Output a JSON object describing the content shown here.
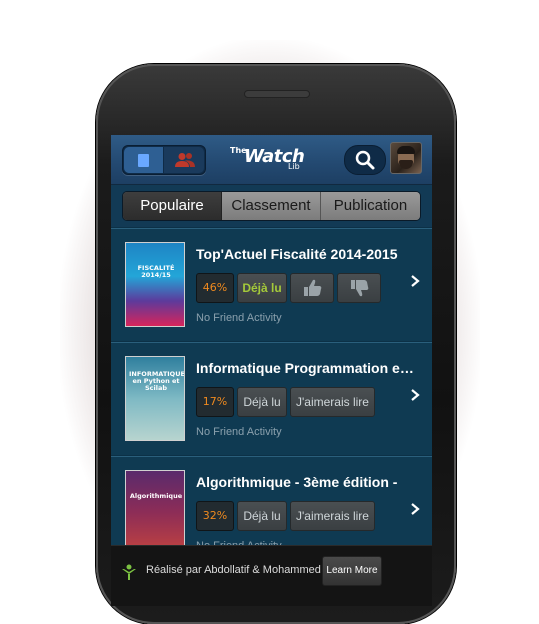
{
  "app": {
    "logo_the": "The",
    "logo_watch": "Watch",
    "logo_lib": "Lib"
  },
  "icons": {
    "books": "book-icon",
    "friends": "users-icon",
    "search": "search-icon",
    "chevron": "chevron-right-icon",
    "like": "thumbs-up-icon",
    "dislike": "thumbs-down-icon"
  },
  "colors": {
    "topbar": "#2f5b86",
    "list_bg": "#0f3a52",
    "percent": "#f08a1f",
    "done": "#a4c93a"
  },
  "tabs": [
    "Populaire",
    "Classement",
    "Publication"
  ],
  "active_tab": "Populaire",
  "books": [
    {
      "title": "Top'Actuel Fiscalité 2014-2015",
      "cover_text": "FISCALITÉ 2014/15",
      "percent": "46%",
      "status": "Déjà lu",
      "activity": "No Friend Activity"
    },
    {
      "title": "Informatique Programmation et Calcul Scientifique",
      "cover_text": "INFORMATIQUE en Python et Scilab",
      "percent": "17%",
      "status": "Déjà lu",
      "wish": "J'aimerais lire",
      "activity": "No Friend Activity"
    },
    {
      "title": "Algorithmique - 3ème édition -",
      "cover_text": "Algorithmique",
      "percent": "32%",
      "status": "Déjà lu",
      "wish": "J'aimerais lire",
      "activity": "No Friend Activity"
    }
  ],
  "footer": {
    "credit": "Réalisé par Abdollatif & Mohammed",
    "learn_more": "Learn More"
  }
}
